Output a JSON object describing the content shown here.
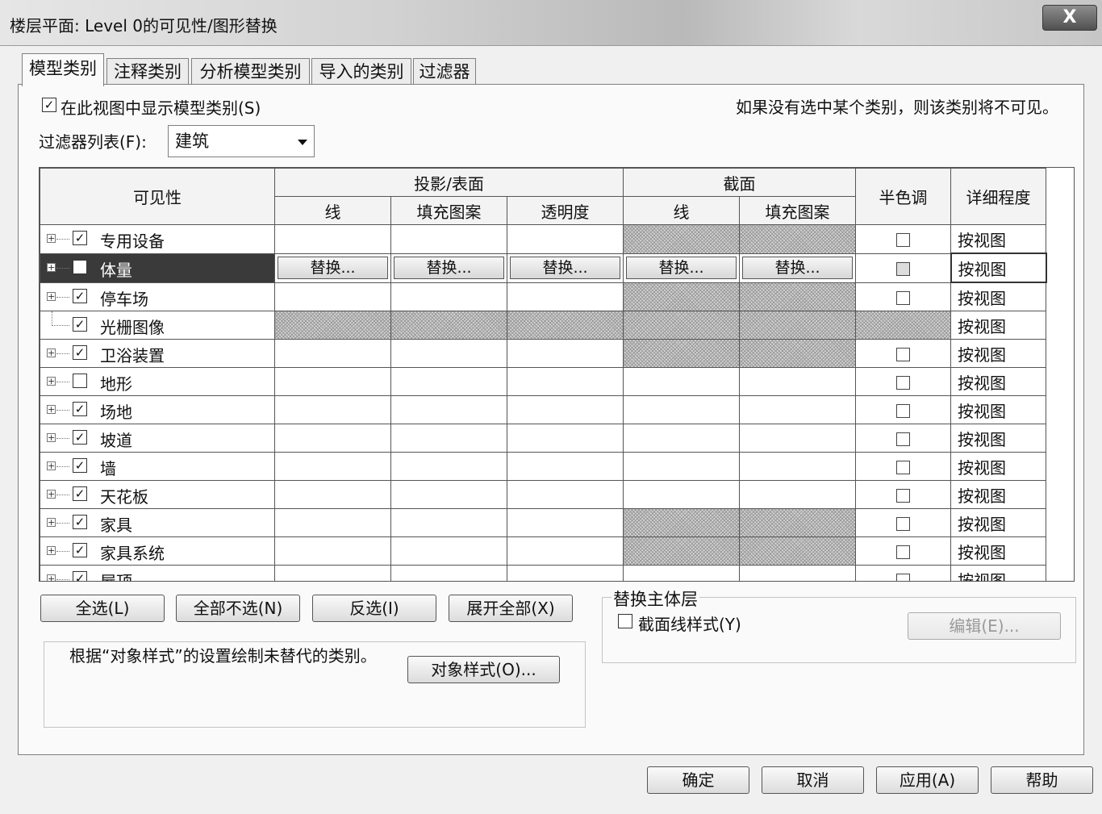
{
  "window": {
    "title": "楼层平面: Level 0的可见性/图形替换",
    "close_label": "X"
  },
  "tabs": [
    {
      "label": "模型类别",
      "active": true
    },
    {
      "label": "注释类别",
      "active": false
    },
    {
      "label": "分析模型类别",
      "active": false
    },
    {
      "label": "导入的类别",
      "active": false
    },
    {
      "label": "过滤器",
      "active": false
    }
  ],
  "options": {
    "show_model_categories_label": "在此视图中显示模型类别(S)",
    "show_model_categories_checked": true,
    "hint": "如果没有选中某个类别，则该类别将不可见。",
    "filter_list_label": "过滤器列表(F):",
    "filter_list_value": "建筑"
  },
  "grid": {
    "headers": {
      "visibility": "可见性",
      "projection_surface": "投影/表面",
      "cut": "截面",
      "halftone": "半色调",
      "detail_level": "详细程度",
      "lines": "线",
      "patterns": "填充图案",
      "transparency": "透明度",
      "cut_lines": "线",
      "cut_patterns": "填充图案"
    },
    "override_label": "替换...",
    "rows": [
      {
        "name": "专用设备",
        "checked": true,
        "expandable": true,
        "cut_hatched": true,
        "all_hatched": false,
        "selected": false,
        "halftone": false,
        "detail": "按视图"
      },
      {
        "name": "体量",
        "checked": true,
        "expandable": true,
        "cut_hatched": false,
        "all_hatched": false,
        "selected": true,
        "halftone": false,
        "detail": "按视图"
      },
      {
        "name": "停车场",
        "checked": true,
        "expandable": true,
        "cut_hatched": true,
        "all_hatched": false,
        "selected": false,
        "halftone": false,
        "detail": "按视图"
      },
      {
        "name": "光栅图像",
        "checked": true,
        "expandable": false,
        "cut_hatched": true,
        "all_hatched": true,
        "selected": false,
        "halftone": false,
        "detail": "按视图"
      },
      {
        "name": "卫浴装置",
        "checked": true,
        "expandable": true,
        "cut_hatched": true,
        "all_hatched": false,
        "selected": false,
        "halftone": false,
        "detail": "按视图"
      },
      {
        "name": "地形",
        "checked": false,
        "expandable": true,
        "cut_hatched": false,
        "all_hatched": false,
        "selected": false,
        "halftone": false,
        "detail": "按视图"
      },
      {
        "name": "场地",
        "checked": true,
        "expandable": true,
        "cut_hatched": false,
        "all_hatched": false,
        "selected": false,
        "halftone": false,
        "detail": "按视图"
      },
      {
        "name": "坡道",
        "checked": true,
        "expandable": true,
        "cut_hatched": false,
        "all_hatched": false,
        "selected": false,
        "halftone": false,
        "detail": "按视图"
      },
      {
        "name": "墙",
        "checked": true,
        "expandable": true,
        "cut_hatched": false,
        "all_hatched": false,
        "selected": false,
        "halftone": false,
        "detail": "按视图"
      },
      {
        "name": "天花板",
        "checked": true,
        "expandable": true,
        "cut_hatched": false,
        "all_hatched": false,
        "selected": false,
        "halftone": false,
        "detail": "按视图"
      },
      {
        "name": "家具",
        "checked": true,
        "expandable": true,
        "cut_hatched": true,
        "all_hatched": false,
        "selected": false,
        "halftone": false,
        "detail": "按视图"
      },
      {
        "name": "家具系统",
        "checked": true,
        "expandable": true,
        "cut_hatched": true,
        "all_hatched": false,
        "selected": false,
        "halftone": false,
        "detail": "按视图"
      },
      {
        "name": "屋顶",
        "checked": true,
        "expandable": true,
        "cut_hatched": false,
        "all_hatched": false,
        "selected": false,
        "halftone": false,
        "detail": "按视图"
      }
    ]
  },
  "buttons": {
    "select_all": "全选(L)",
    "select_none": "全部不选(N)",
    "invert": "反选(I)",
    "expand_all": "展开全部(X)",
    "object_styles": "对象样式(O)...",
    "edit": "编辑(E)...",
    "ok": "确定",
    "cancel": "取消",
    "apply": "应用(A)",
    "help": "帮助"
  },
  "info": {
    "text": "根据“对象样式”的设置绘制未替代的类别。"
  },
  "host_layers": {
    "title": "替换主体层",
    "cut_line_styles_label": "截面线样式(Y)",
    "cut_line_styles_checked": false
  }
}
